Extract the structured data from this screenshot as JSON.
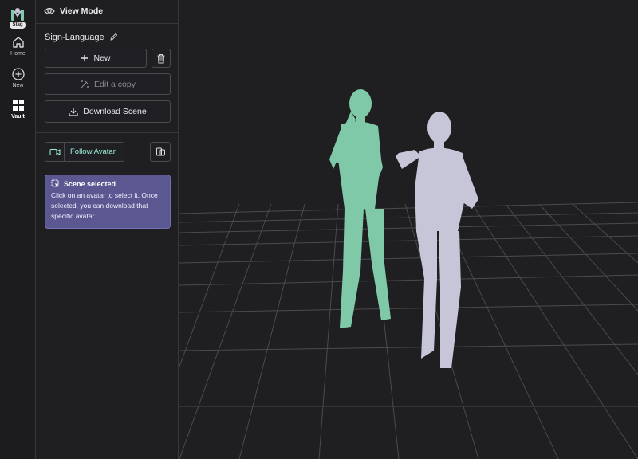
{
  "sidebar": {
    "logo_badge": "Stag",
    "items": [
      {
        "label": "Home",
        "icon": "home-icon"
      },
      {
        "label": "New",
        "icon": "plus-circle-icon"
      },
      {
        "label": "Vault",
        "icon": "grid-icon"
      }
    ]
  },
  "panel": {
    "mode_title": "View Mode",
    "scene_name": "Sign-Language",
    "new_label": "New",
    "edit_copy_label": "Edit a copy",
    "download_label": "Download Scene",
    "follow_label": "Follow Avatar",
    "notice": {
      "title": "Scene selected",
      "body": "Click on an avatar to select it. Once selected, you can download that specific avatar."
    }
  },
  "colors": {
    "avatar_green": "#7fc9a8",
    "avatar_lilac": "#c7c5d8",
    "notice_bg": "#5b5791",
    "accent_text": "#9ef0d6"
  }
}
